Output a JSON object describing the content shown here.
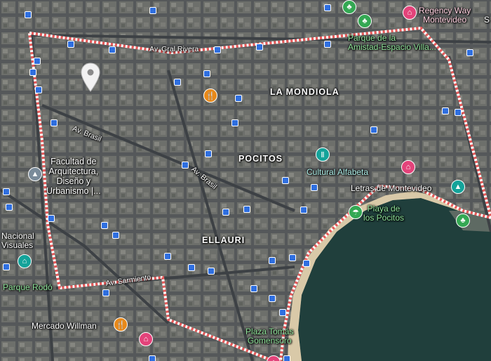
{
  "map": {
    "areas": {
      "la_mondiola": "LA MONDIOLA",
      "pocitos": "POCITOS",
      "ellauri": "ELLAURI"
    },
    "roads": {
      "gral_rivera": "Av. Gral Rivera",
      "brasil_1": "Av. Brasil",
      "brasil_2": "Av. Brasil",
      "sarmiento": "Av. Sarmiento"
    },
    "places": {
      "regency": "Regency Way\nMontevideo",
      "parque_amistad": "Parque de la\nAmistad-Espacio Villa...",
      "facultad": "Facultad de\nArquitectura,\nDiseño y\nUrbanismo |...",
      "cultural": "Cultural Alfabeta",
      "letras": "Letras de Montevideo",
      "playa": "Playa de\nlos Pocitos",
      "nacional": "Nacional\nVisuales",
      "parque_rodo": "Parque Rodó",
      "mercado": "Mercado Willman",
      "plaza": "Plaza Tomás\nGomensoro",
      "corner_top": "S"
    },
    "colors": {
      "boundary": "#e85a5a",
      "water": "#203f3c",
      "beach": "#d9c9a8",
      "transit": "#2f6fe0",
      "park": "#34a853",
      "food": "#e8891a",
      "hotel": "#e3437a",
      "culture": "#14a39a"
    },
    "icons": [
      "dropped-pin-icon",
      "bus-stop-icon",
      "restaurant-icon",
      "hotel-icon",
      "park-icon",
      "monument-icon",
      "school-icon",
      "museum-icon",
      "beach-icon"
    ]
  }
}
